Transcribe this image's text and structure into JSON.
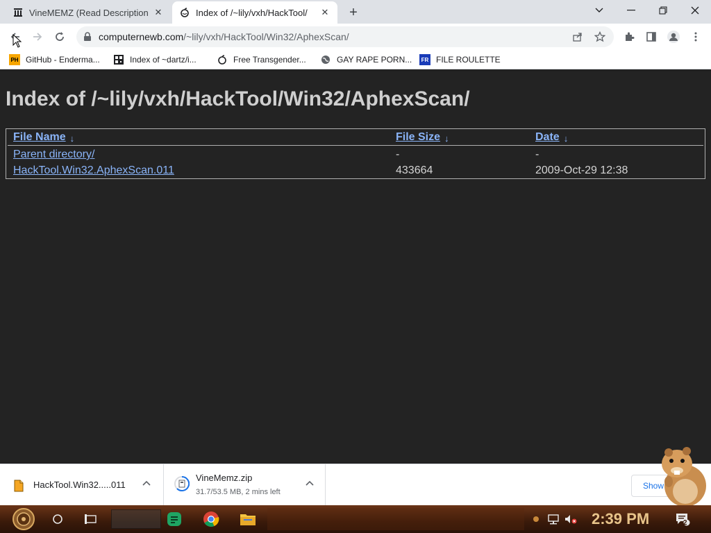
{
  "browser": {
    "tabs": [
      {
        "title": "VineMEMZ (Read Description)",
        "favicon": "building-icon",
        "active": false
      },
      {
        "title": "Index of /~lily/vxh/HackTool/",
        "favicon": "apple-icon",
        "active": true
      }
    ],
    "address": {
      "host": "computernewb.com",
      "path": "/~lily/vxh/HackTool/Win32/AphexScan/"
    },
    "bookmarks": [
      {
        "label": "GitHub - Enderma...",
        "icon": "PH"
      },
      {
        "label": "Index of ~dartz/i...",
        "icon": "qr-icon"
      },
      {
        "label": "Free Transgender...",
        "icon": "apple-icon"
      },
      {
        "label": "GAY RAPE PORN...",
        "icon": "globe-icon"
      },
      {
        "label": "FILE ROULETTE",
        "icon": "FR"
      }
    ]
  },
  "page": {
    "title": "Index of /~lily/vxh/HackTool/Win32/AphexScan/",
    "columns": {
      "name": "File Name",
      "size": "File Size",
      "date": "Date",
      "sort_glyph": "↓"
    },
    "rows": [
      {
        "name": "Parent directory/",
        "size": "-",
        "date": "-"
      },
      {
        "name": "HackTool.Win32.AphexScan.011",
        "size": "433664",
        "date": "2009-Oct-29 12:38"
      }
    ]
  },
  "downloads": [
    {
      "name": "HackTool.Win32.....011",
      "status": ""
    },
    {
      "name": "VineMemz.zip",
      "status": "31.7/53.5 MB, 2 mins left"
    }
  ],
  "show_all_label": "Show",
  "taskbar": {
    "clock": "2:39 PM",
    "notification_count": "2"
  },
  "colors": {
    "link": "#8ab4f8",
    "page_bg": "#232323",
    "taskbar": "#4a2410",
    "clock": "#e8c48a"
  }
}
